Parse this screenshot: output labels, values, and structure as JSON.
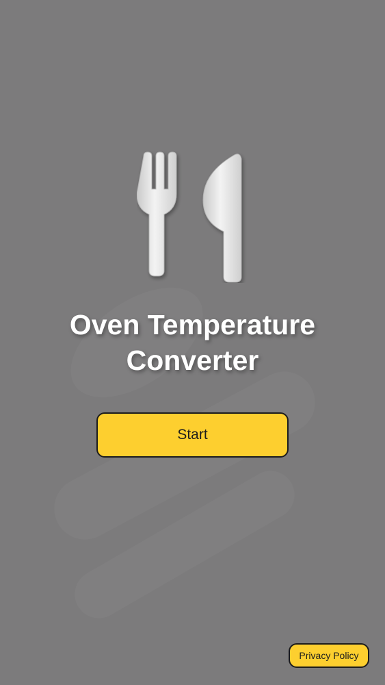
{
  "app": {
    "title_line1": "Oven Temperature",
    "title_line2": "Converter"
  },
  "actions": {
    "start_label": "Start",
    "privacy_label": "Privacy Policy"
  },
  "icons": {
    "logo": "fork-and-knife-icon"
  },
  "colors": {
    "background": "#7c7b7c",
    "button": "#fdcf2f",
    "button_border": "#1c1c1c",
    "title": "#ffffff"
  }
}
